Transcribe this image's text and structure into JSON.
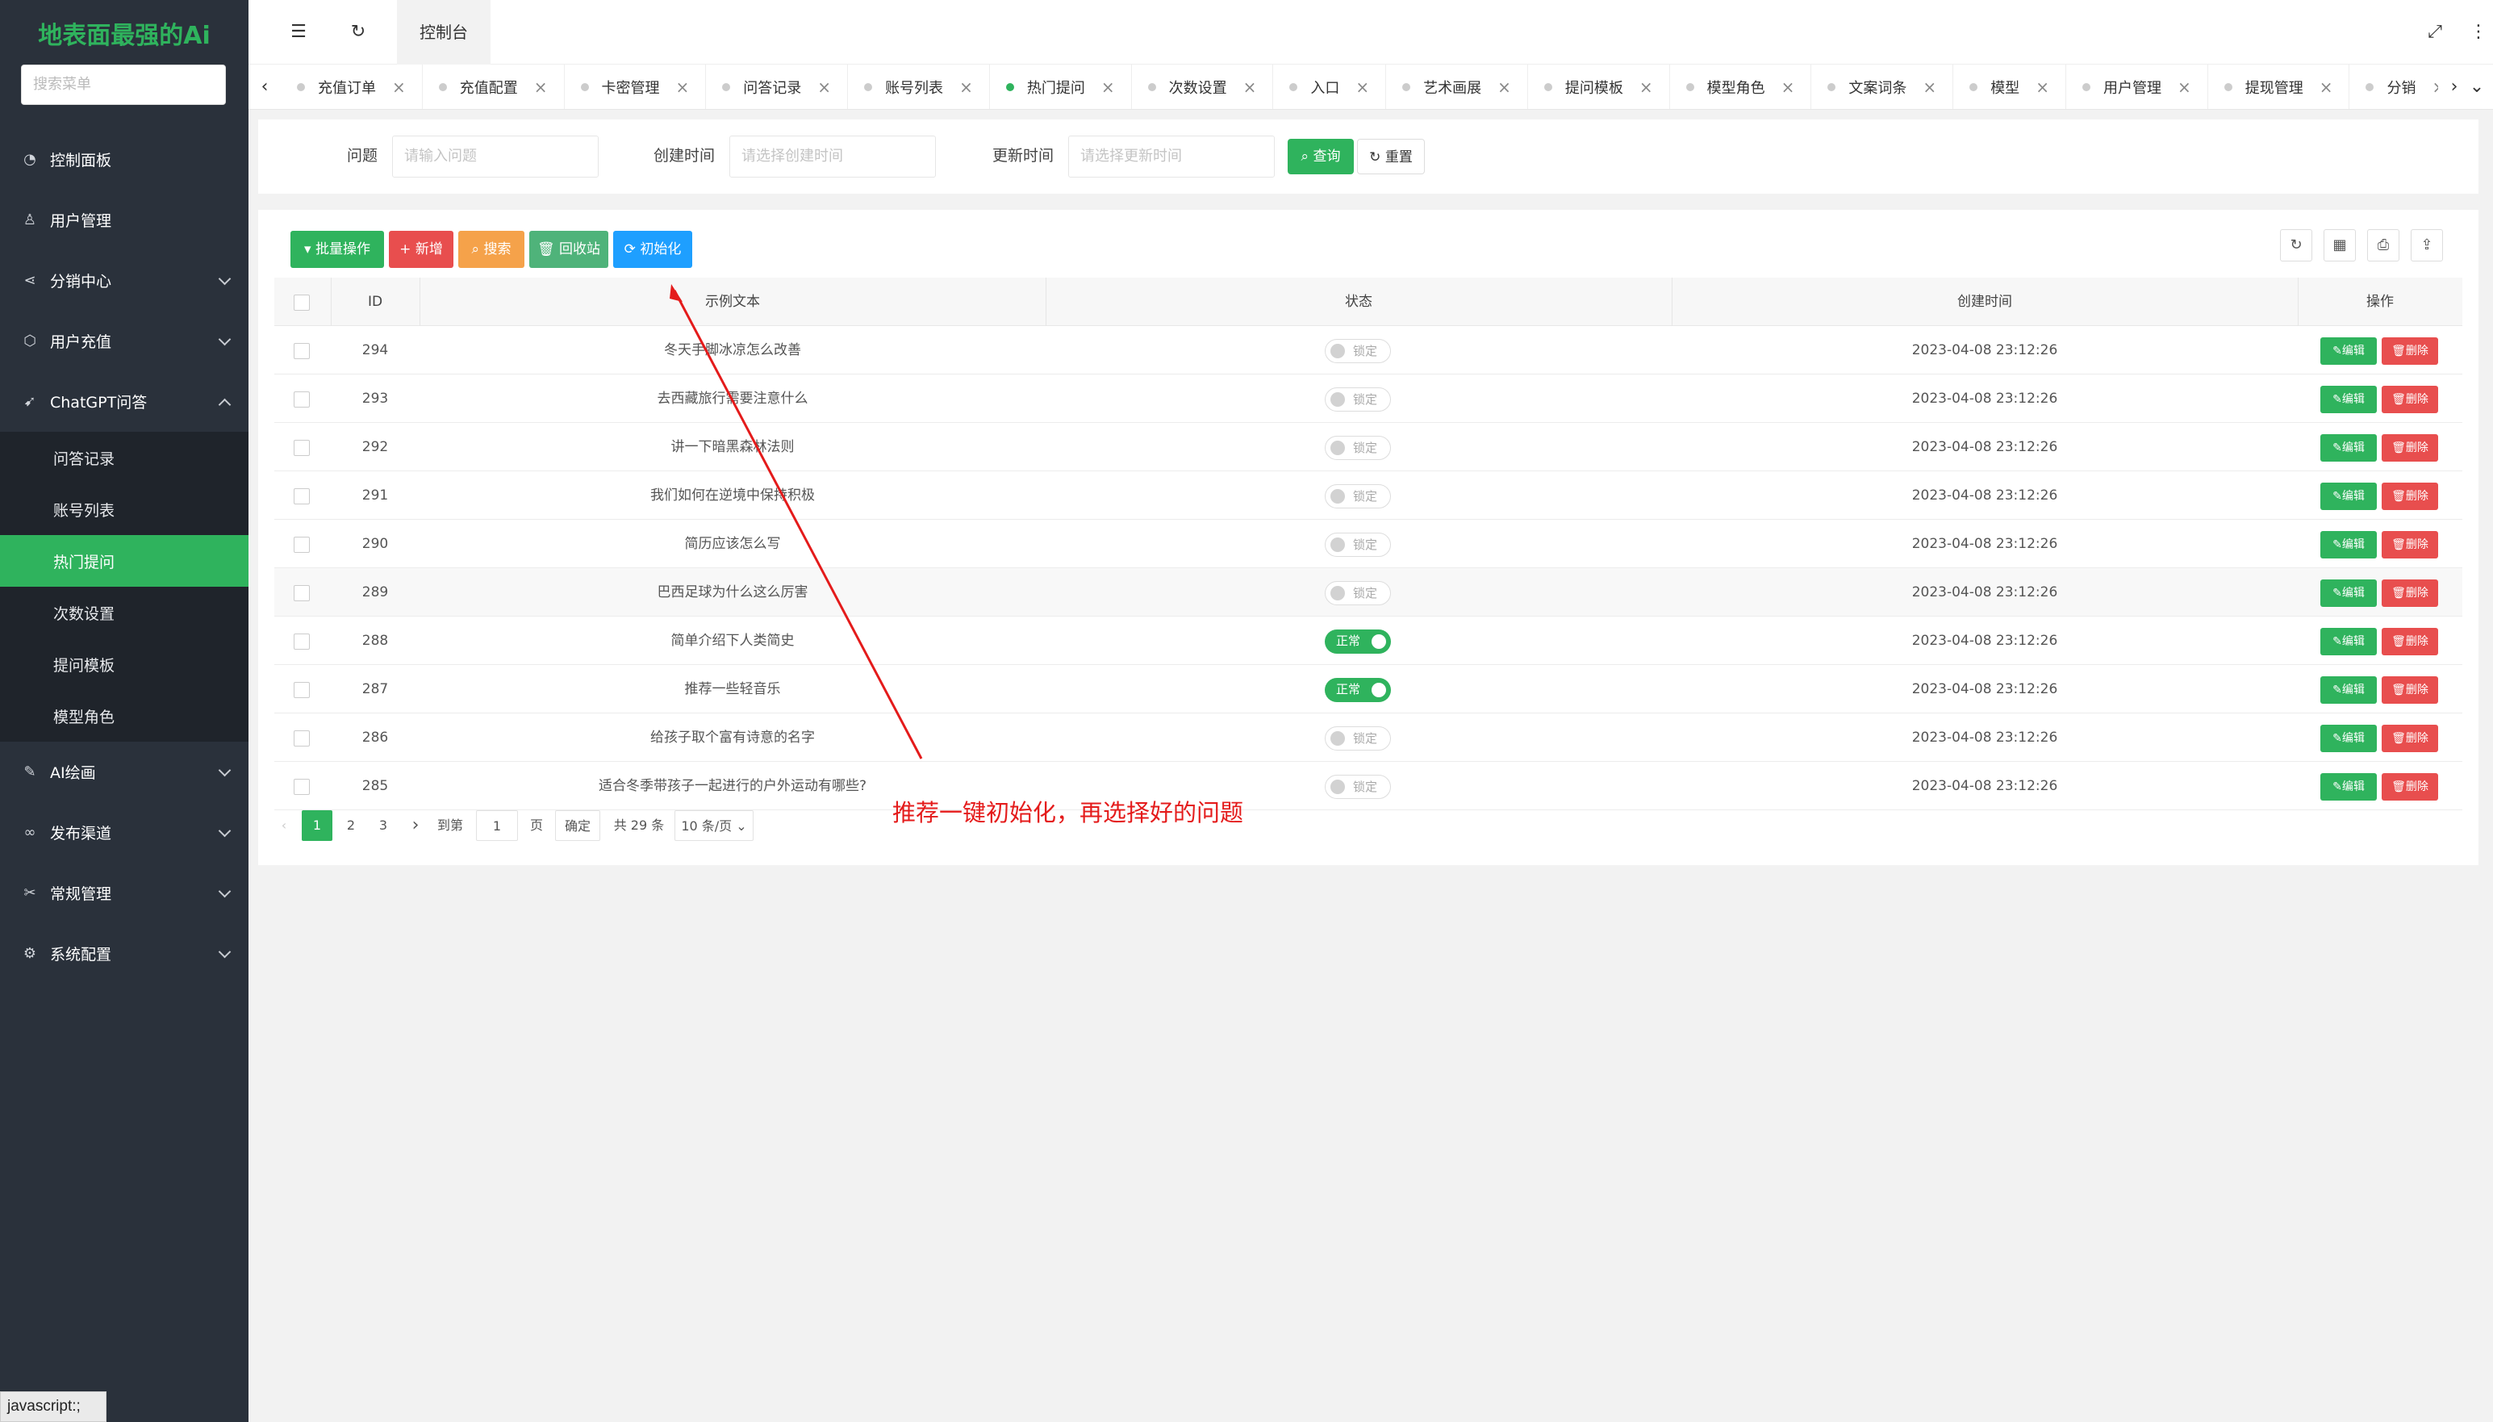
{
  "app": {
    "title": "地表面最强的Ai",
    "search_placeholder": "搜索菜单"
  },
  "sidebar": {
    "items": [
      {
        "label": "控制面板",
        "icon": "dashboard-icon"
      },
      {
        "label": "用户管理",
        "icon": "user-icon"
      },
      {
        "label": "分销中心",
        "icon": "share-icon"
      },
      {
        "label": "用户充值",
        "icon": "box-icon"
      },
      {
        "label": "ChatGPT问答",
        "icon": "send-icon"
      },
      {
        "label": "AI绘画",
        "icon": "brush-icon"
      },
      {
        "label": "发布渠道",
        "icon": "link-icon"
      },
      {
        "label": "常规管理",
        "icon": "tools-icon"
      },
      {
        "label": "系统配置",
        "icon": "gear-icon"
      }
    ],
    "sub_items": [
      "问答记录",
      "账号列表",
      "热门提问",
      "次数设置",
      "提问模板",
      "模型角色"
    ]
  },
  "header": {
    "tab": "控制台"
  },
  "tabs": [
    "充值订单",
    "充值配置",
    "卡密管理",
    "问答记录",
    "账号列表",
    "热门提问",
    "次数设置",
    "入口",
    "艺术画展",
    "提问模板",
    "模型角色",
    "文案词条",
    "模型",
    "用户管理",
    "提现管理",
    "分销"
  ],
  "filter": {
    "q_label": "问题",
    "q_placeholder": "请输入问题",
    "created_label": "创建时间",
    "created_placeholder": "请选择创建时间",
    "updated_label": "更新时间",
    "updated_placeholder": "请选择更新时间",
    "search_btn": "查询",
    "reset_btn": "重置"
  },
  "toolbar": {
    "batch": "批量操作",
    "add": "新增",
    "search": "搜索",
    "recycle": "回收站",
    "init": "初始化"
  },
  "table": {
    "headers": {
      "id": "ID",
      "text": "示例文本",
      "status": "状态",
      "created": "创建时间",
      "ops": "操作"
    },
    "rows": [
      {
        "id": "294",
        "text": "冬天手脚冰凉怎么改善",
        "status": "锁定",
        "on": false,
        "created": "2023-04-08 23:12:26"
      },
      {
        "id": "293",
        "text": "去西藏旅行需要注意什么",
        "status": "锁定",
        "on": false,
        "created": "2023-04-08 23:12:26"
      },
      {
        "id": "292",
        "text": "讲一下暗黑森林法则",
        "status": "锁定",
        "on": false,
        "created": "2023-04-08 23:12:26"
      },
      {
        "id": "291",
        "text": "我们如何在逆境中保持积极",
        "status": "锁定",
        "on": false,
        "created": "2023-04-08 23:12:26"
      },
      {
        "id": "290",
        "text": "简历应该怎么写",
        "status": "锁定",
        "on": false,
        "created": "2023-04-08 23:12:26"
      },
      {
        "id": "289",
        "text": "巴西足球为什么这么厉害",
        "status": "锁定",
        "on": false,
        "created": "2023-04-08 23:12:26"
      },
      {
        "id": "288",
        "text": "简单介绍下人类简史",
        "status": "正常",
        "on": true,
        "created": "2023-04-08 23:12:26"
      },
      {
        "id": "287",
        "text": "推荐一些轻音乐",
        "status": "正常",
        "on": true,
        "created": "2023-04-08 23:12:26"
      },
      {
        "id": "286",
        "text": "给孩子取个富有诗意的名字",
        "status": "锁定",
        "on": false,
        "created": "2023-04-08 23:12:26"
      },
      {
        "id": "285",
        "text": "适合冬季带孩子一起进行的户外运动有哪些?",
        "status": "锁定",
        "on": false,
        "created": "2023-04-08 23:12:26"
      }
    ],
    "edit": "编辑",
    "delete": "删除"
  },
  "pagination": {
    "pages": [
      "1",
      "2",
      "3"
    ],
    "goto": "到第",
    "goto_value": "1",
    "page_unit": "页",
    "confirm": "确定",
    "total": "共 29 条",
    "per_page": "10 条/页"
  },
  "annotation": "推荐一键初始化，再选择好的问题",
  "statusbar": "javascript:;",
  "colors": {
    "green": "#2fb35d",
    "red": "#e84e4e",
    "orange": "#f5a24a",
    "blue": "#1e9fff",
    "sidebar": "#2a313b"
  }
}
